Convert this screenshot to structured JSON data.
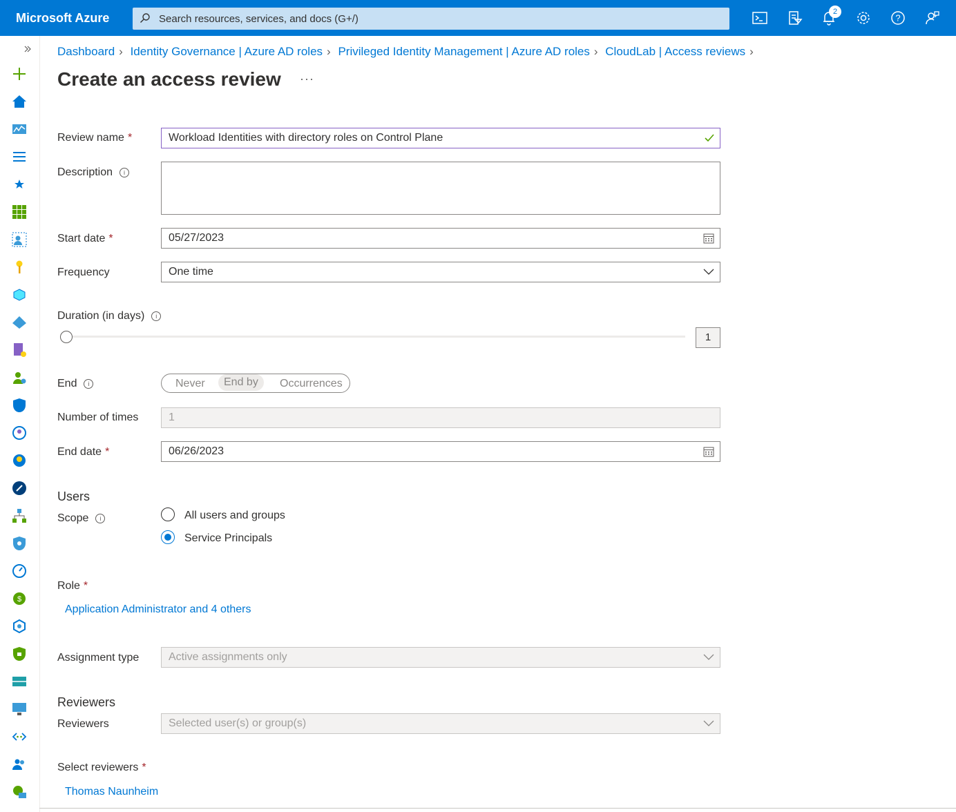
{
  "topbar": {
    "brand": "Microsoft Azure",
    "search_placeholder": "Search resources, services, and docs (G+/)",
    "notification_count": "2"
  },
  "breadcrumb": [
    "Dashboard",
    "Identity Governance | Azure AD roles",
    "Privileged Identity Management | Azure AD roles",
    "CloudLab | Access reviews"
  ],
  "page": {
    "title": "Create an access review",
    "more": "···"
  },
  "form": {
    "review_name_label": "Review name",
    "review_name_value": "Workload Identities with directory roles on Control Plane",
    "description_label": "Description",
    "description_value": "",
    "start_date_label": "Start date",
    "start_date_value": "05/27/2023",
    "frequency_label": "Frequency",
    "frequency_value": "One time",
    "duration_label": "Duration (in days)",
    "duration_value": "1",
    "end_label": "End",
    "end_options": [
      "Never",
      "End by",
      "Occurrences"
    ],
    "end_selected": "End by",
    "number_of_times_label": "Number of times",
    "number_of_times_value": "1",
    "end_date_label": "End date",
    "end_date_value": "06/26/2023",
    "users_section": "Users",
    "scope_label": "Scope",
    "scope_options": [
      "All users and groups",
      "Service Principals"
    ],
    "scope_selected": "Service Principals",
    "role_label": "Role",
    "role_value": "Application Administrator and 4 others",
    "assignment_type_label": "Assignment type",
    "assignment_type_value": "Active assignments only",
    "reviewers_section": "Reviewers",
    "reviewers_label": "Reviewers",
    "reviewers_value": "Selected user(s) or group(s)",
    "select_reviewers_label": "Select reviewers",
    "select_reviewers_value": "Thomas Naunheim"
  },
  "required_mark": "*",
  "colors": {
    "accent": "#0078d4",
    "required": "#a4262c"
  }
}
